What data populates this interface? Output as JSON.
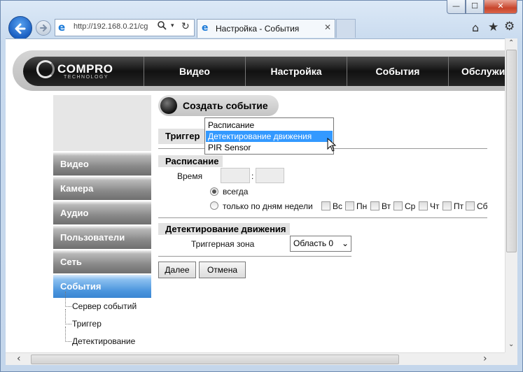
{
  "browser": {
    "window_controls": {
      "minimize": "—",
      "maximize": "☐",
      "close": "✕"
    },
    "address": "http://192.168.0.21/cg",
    "tab_title": "Настройка - События",
    "tab_close": "✕",
    "icons": {
      "back": "back-arrow-icon",
      "forward": "forward-arrow-icon",
      "ie": "ie-icon",
      "search": "search-icon",
      "refresh": "refresh-icon",
      "home": "home-icon",
      "favorites": "star-icon",
      "tools": "gear-icon"
    }
  },
  "site": {
    "logo": "COMPRO",
    "logo_sub": "TECHNOLOGY",
    "nav": [
      "Видео",
      "Настройка",
      "События",
      "Обслужи"
    ]
  },
  "sidebar": {
    "items": [
      {
        "label": "Видео",
        "active": false
      },
      {
        "label": "Камера",
        "active": false
      },
      {
        "label": "Аудио",
        "active": false
      },
      {
        "label": "Пользователи",
        "active": false
      },
      {
        "label": "Сеть",
        "active": false
      },
      {
        "label": "События",
        "active": true
      }
    ],
    "subitems": [
      "Сервер событий",
      "Триггер",
      "Детектирование"
    ]
  },
  "form": {
    "title": "Создать событие",
    "trigger_section": "Триггер",
    "trigger_options": [
      "Расписание",
      "Детектирование движения",
      "PIR Sensor"
    ],
    "trigger_selected": "Детектирование движения",
    "schedule_section": "Расписание",
    "time_label": "Время",
    "time_separator": ":",
    "radio_always": "всегда",
    "radio_days": "только по дням недели",
    "days": [
      "Вс",
      "Пн",
      "Вт",
      "Ср",
      "Чт",
      "Пт",
      "Сб"
    ],
    "motion_section": "Детектирование движения",
    "zone_label": "Триггерная зона",
    "zone_value": "Область 0",
    "next_button": "Далее",
    "cancel_button": "Отмена"
  }
}
